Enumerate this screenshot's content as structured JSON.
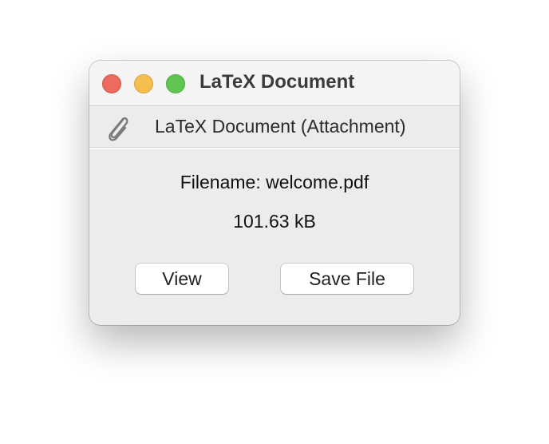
{
  "window": {
    "title": "LaTeX Document"
  },
  "attachment": {
    "icon": "paperclip-icon",
    "label": "LaTeX Document (Attachment)"
  },
  "file": {
    "filename_line": "Filename: welcome.pdf",
    "size": "101.63 kB"
  },
  "buttons": {
    "view_label": "View",
    "save_label": "Save File"
  },
  "colors": {
    "close": "#ec6a5e",
    "minimize": "#f4bf4f",
    "zoom": "#61c554",
    "window_bg": "#ececec"
  }
}
